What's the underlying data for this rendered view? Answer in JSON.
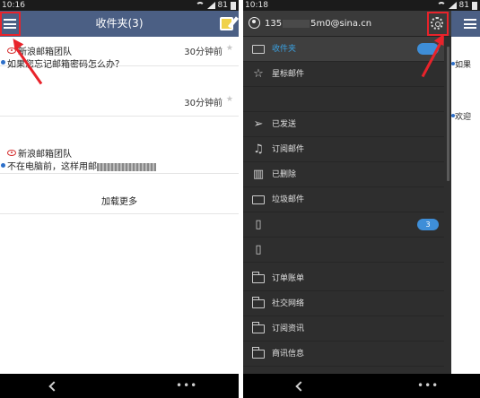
{
  "left": {
    "status": {
      "time": "10:16",
      "battery": "81"
    },
    "title": "收件夹(3)",
    "mails": [
      {
        "sender": "新浪邮箱团队",
        "time": "30分钟前",
        "subject": "如果您忘记邮箱密码怎么办？"
      },
      {
        "sender": "",
        "time": "30分钟前",
        "subject": ""
      },
      {
        "sender": "新浪邮箱团队",
        "time": "",
        "subject": "不在电脑前，这样用邮"
      }
    ],
    "load_more": "加载更多"
  },
  "right": {
    "status": {
      "time": "10:18",
      "battery": "81"
    },
    "account": {
      "prefix": "135",
      "suffix": "5m0@sina.cn"
    },
    "menu": [
      {
        "label": "收件夹",
        "icon": "envelope-icon",
        "active": true
      },
      {
        "label": "星标邮件",
        "icon": "star-icon"
      },
      {
        "label": "",
        "icon": ""
      },
      {
        "label": "已发送",
        "icon": "paper-plane-icon"
      },
      {
        "label": "订阅邮件",
        "icon": "bell-icon"
      },
      {
        "label": "已删除",
        "icon": "trash-icon"
      },
      {
        "label": "垃圾邮件",
        "icon": "spam-envelope-icon"
      },
      {
        "label": "",
        "icon": "phone-icon",
        "badge": "3"
      },
      {
        "label": "",
        "icon": "phone-icon"
      },
      {
        "label": "订单账单",
        "icon": "folder-icon"
      },
      {
        "label": "社交网络",
        "icon": "folder-icon"
      },
      {
        "label": "订阅资讯",
        "icon": "folder-icon"
      },
      {
        "label": "商讯信息",
        "icon": "folder-icon"
      }
    ],
    "behind": [
      {
        "text": "如果"
      },
      {
        "text": "欢迎"
      }
    ]
  },
  "colors": {
    "app_bar": "#4b5f84",
    "highlight": "#e8232b",
    "drawer_bg": "#2e2e2e",
    "accent": "#3aa0e0",
    "unread_dot": "#2d6fc9"
  }
}
